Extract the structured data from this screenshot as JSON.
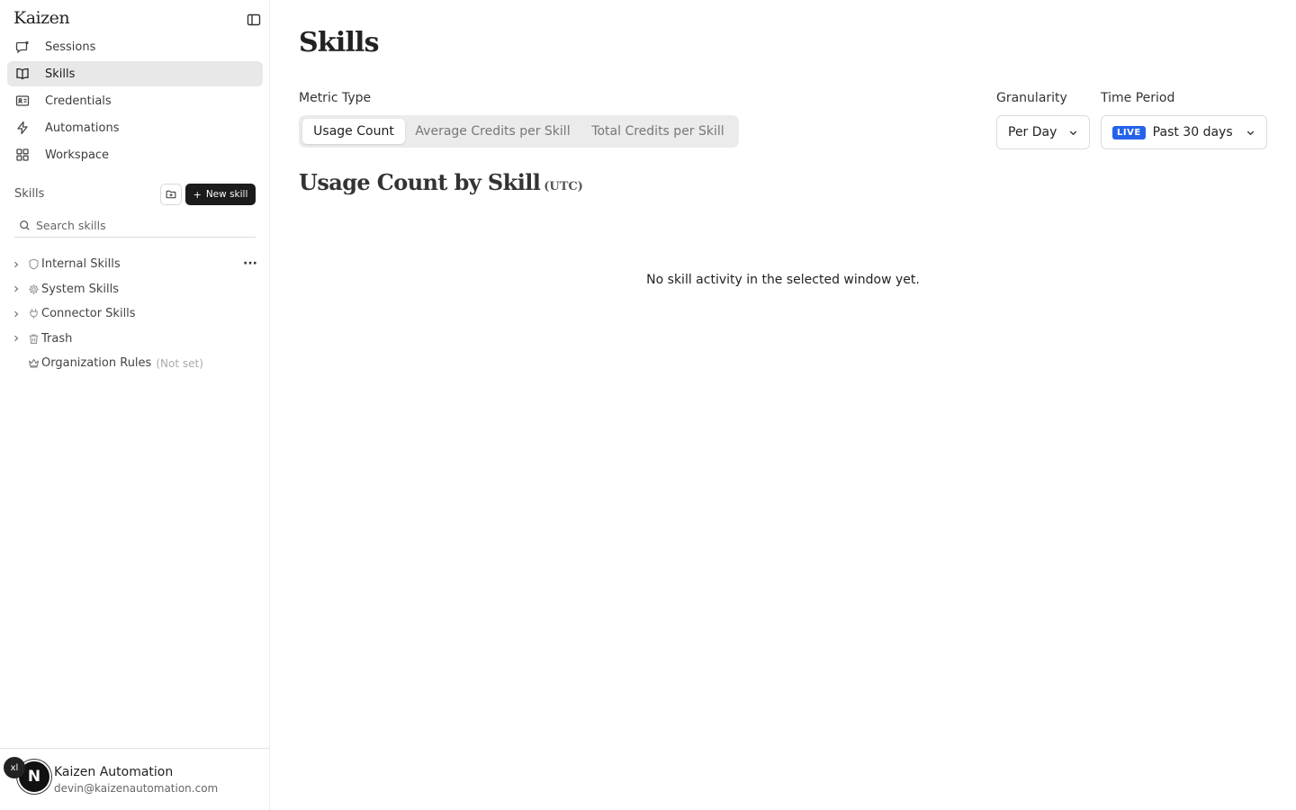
{
  "app": {
    "brand": "Kaizen"
  },
  "nav": {
    "items": [
      {
        "label": "Sessions",
        "icon": "chat-bubble-icon"
      },
      {
        "label": "Skills",
        "icon": "book-icon",
        "active": true
      },
      {
        "label": "Credentials",
        "icon": "id-card-icon"
      },
      {
        "label": "Automations",
        "icon": "lightning-icon"
      },
      {
        "label": "Workspace",
        "icon": "grid-icon"
      }
    ]
  },
  "skills_panel": {
    "heading": "Skills",
    "new_skill_label": "New skill",
    "search_placeholder": "Search skills",
    "tree": [
      {
        "label": "Internal Skills",
        "icon": "shield-icon"
      },
      {
        "label": "System Skills",
        "icon": "gear-icon"
      },
      {
        "label": "Connector Skills",
        "icon": "plug-icon"
      },
      {
        "label": "Trash",
        "icon": "trash-icon"
      },
      {
        "label": "Organization Rules",
        "note": "(Not set)",
        "icon": "crown-icon"
      }
    ]
  },
  "user": {
    "initial": "N",
    "name": "Kaizen Automation",
    "email": "devin@kaizenautomation.com",
    "badge": "xl"
  },
  "main": {
    "title": "Skills",
    "metric_type": {
      "label": "Metric Type",
      "options": [
        "Usage Count",
        "Average Credits per Skill",
        "Total Credits per Skill"
      ],
      "selected": "Usage Count"
    },
    "granularity": {
      "label": "Granularity",
      "value": "Per Day"
    },
    "time_period": {
      "label": "Time Period",
      "live_badge": "LIVE",
      "value": "Past 30 days"
    },
    "chart_title": "Usage Count by Skill",
    "chart_timezone": "(UTC)",
    "empty_message": "No skill activity in the selected window yet."
  },
  "colors": {
    "accent": "#2563eb",
    "primary_button": "#1b1b1b",
    "active_nav_bg": "#e8e8e8"
  }
}
